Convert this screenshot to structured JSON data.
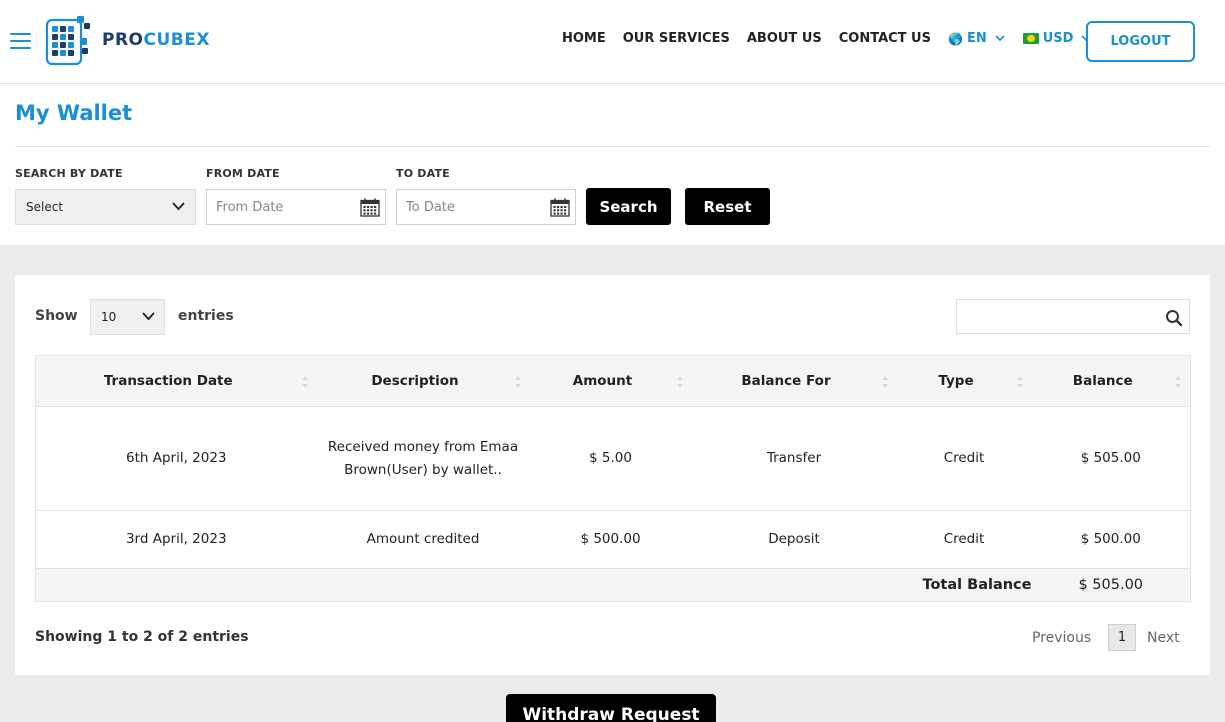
{
  "header": {
    "logo_text_dark": "PRO",
    "logo_text_light": "CUBEX",
    "nav": [
      "HOME",
      "OUR SERVICES",
      "ABOUT US",
      "CONTACT US"
    ],
    "language": "EN",
    "currency": "USD",
    "logout": "LOGOUT"
  },
  "page": {
    "title": "My Wallet"
  },
  "filters": {
    "search_by_date_label": "SEARCH BY DATE",
    "search_by_date_value": "Select",
    "from_date_label": "FROM DATE",
    "from_date_placeholder": "From Date",
    "to_date_label": "TO DATE",
    "to_date_placeholder": "To Date",
    "search_button": "Search",
    "reset_button": "Reset"
  },
  "table_controls": {
    "show_label": "Show",
    "entries_value": "10",
    "entries_label": "entries",
    "search_placeholder": ""
  },
  "table": {
    "columns": [
      "Transaction Date",
      "Description",
      "Amount",
      "Balance For",
      "Type",
      "Balance"
    ],
    "rows": [
      {
        "date": "6th April, 2023",
        "description": "Received money from Emaa Brown(User) by wallet..",
        "amount": "$ 5.00",
        "balance_for": "Transfer",
        "type": "Credit",
        "balance": "$ 505.00"
      },
      {
        "date": "3rd April, 2023",
        "description": "Amount credited",
        "amount": "$ 500.00",
        "balance_for": "Deposit",
        "type": "Credit",
        "balance": "$ 500.00"
      }
    ],
    "total_label": "Total Balance",
    "total_value": "$ 505.00"
  },
  "pagination": {
    "summary": "Showing 1 to 2 of 2 entries",
    "previous": "Previous",
    "current_page": "1",
    "next": "Next"
  },
  "actions": {
    "withdraw_request": "Withdraw Request"
  },
  "colors": {
    "brand_blue": "#1a8fd6",
    "brand_navy": "#1c3c6e",
    "band_grey": "#ececec"
  }
}
